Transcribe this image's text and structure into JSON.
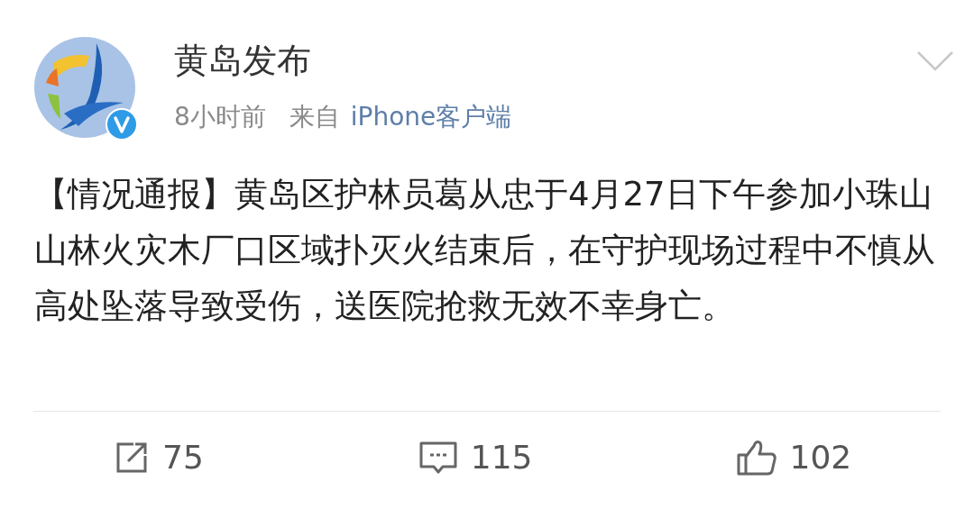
{
  "post": {
    "author": "黄岛发布",
    "verified": true,
    "time": "8小时前",
    "source_label": "来自",
    "source": "iPhone客户端",
    "text": "【情况通报】黄岛区护林员葛从忠于4月27日下午参加小珠山山林火灾木厂口区域扑灭火结束后，在守护现场过程中不慎从高处坠落导致受伤，送医院抢救无效不幸身亡。"
  },
  "actions": [
    {
      "kind": "repost",
      "count": "75"
    },
    {
      "kind": "comment",
      "count": "115"
    },
    {
      "kind": "like",
      "count": "102"
    }
  ]
}
